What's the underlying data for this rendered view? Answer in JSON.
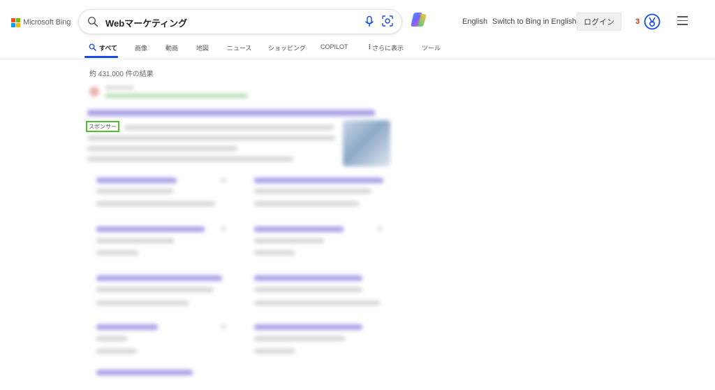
{
  "header": {
    "logo_text": "Microsoft Bing",
    "search_query": "Webマーケティング",
    "lang_link": "English",
    "switch_link": "Switch to Bing in English",
    "login_label": "ログイン",
    "reward_points": "3"
  },
  "tabs": [
    {
      "label": "すべて",
      "active": true
    },
    {
      "label": "画像"
    },
    {
      "label": "動画"
    },
    {
      "label": "地図"
    },
    {
      "label": "ニュース"
    },
    {
      "label": "ショッピング"
    },
    {
      "label": "COPILOT"
    },
    {
      "label": "さらに表示"
    },
    {
      "label": "ツール"
    }
  ],
  "results": {
    "count_text": "約 431,000 件の結果",
    "sponsor_label": "スポンサー"
  },
  "colors": {
    "accent": "#174ae4",
    "highlight": "#4bc428",
    "ms_red": "#f25022",
    "ms_green": "#7fba00",
    "ms_blue": "#00a4ef",
    "ms_yellow": "#ffb900"
  }
}
